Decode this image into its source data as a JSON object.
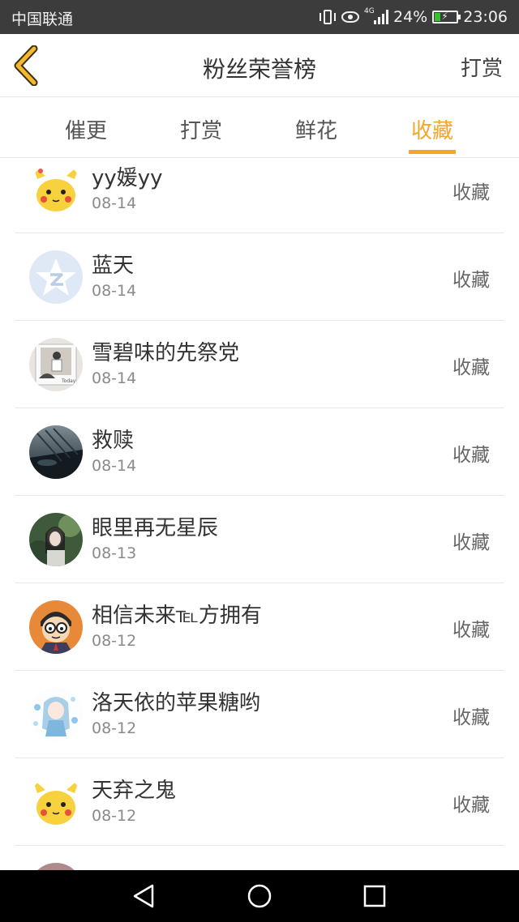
{
  "status_bar": {
    "carrier": "中国联通",
    "network_tag": "4G",
    "battery": "24%",
    "time": "23:06"
  },
  "header": {
    "title": "粉丝荣誉榜",
    "action": "打赏"
  },
  "tabs": [
    {
      "label": "催更",
      "active": false
    },
    {
      "label": "打赏",
      "active": false
    },
    {
      "label": "鲜花",
      "active": false
    },
    {
      "label": "收藏",
      "active": true
    }
  ],
  "colors": {
    "accent": "#f5a623",
    "status_bar": "#3c3c3c",
    "nav_bar": "#000000"
  },
  "fans": [
    {
      "name": "yy媛yy",
      "date": "08-14",
      "action": "收藏",
      "avatar": "pikachu-avatar"
    },
    {
      "name": "蓝天",
      "date": "08-14",
      "action": "收藏",
      "avatar": "qq-default-avatar"
    },
    {
      "name": "雪碧味的先祭党",
      "date": "08-14",
      "action": "收藏",
      "avatar": "photo-avatar"
    },
    {
      "name": "救赎",
      "date": "08-14",
      "action": "收藏",
      "avatar": "bridge-photo-avatar"
    },
    {
      "name": "眼里再无星辰",
      "date": "08-13",
      "action": "收藏",
      "avatar": "girl-photo-avatar"
    },
    {
      "name": "相信未来℡方拥有",
      "date": "08-12",
      "action": "收藏",
      "avatar": "cartoon-boy-avatar"
    },
    {
      "name": "洛天依的苹果糖哟",
      "date": "08-12",
      "action": "收藏",
      "avatar": "anime-girl-avatar"
    },
    {
      "name": "天弃之鬼",
      "date": "08-12",
      "action": "收藏",
      "avatar": "pikachu-avatar"
    }
  ],
  "navbar": {
    "icons": [
      "back-triangle-icon",
      "home-circle-icon",
      "recents-square-icon"
    ]
  }
}
